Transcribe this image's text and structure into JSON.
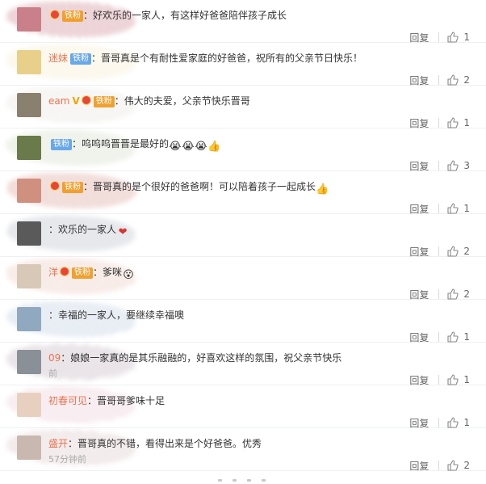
{
  "labels": {
    "reply": "回复"
  },
  "comments": [
    {
      "user": "",
      "fan": "铁粉",
      "fan_color": "orange",
      "medal": true,
      "vip": false,
      "text": "：好欢乐的一家人，有这样好爸爸陪伴孩子成长",
      "emojis": [],
      "time": "",
      "likes": "1",
      "avatar_color": "#c9808a",
      "scribble": "#b04050"
    },
    {
      "user": "迷妹",
      "fan": "铁粉",
      "fan_color": "blue",
      "medal": false,
      "vip": false,
      "text": "：晋哥真是个有耐性爱家庭的好爸爸，祝所有的父亲节日快乐！",
      "emojis": [],
      "time": "",
      "likes": "2",
      "avatar_color": "#e8d08a",
      "scribble": "#f0e0b0"
    },
    {
      "user": "eam",
      "fan": "铁粉",
      "fan_color": "orange",
      "medal": true,
      "vip": true,
      "text": "：伟大的夫爱，父亲节快乐晋哥",
      "emojis": [],
      "time": "",
      "likes": "1",
      "avatar_color": "#8a8070",
      "scribble": "#d8d4cc"
    },
    {
      "user": "",
      "fan": "铁粉",
      "fan_color": "blue",
      "medal": false,
      "vip": false,
      "text": "：呜呜呜晋晋是最好的",
      "emojis": [
        "😭",
        "😭",
        "😭",
        "👍"
      ],
      "time": "",
      "likes": "3",
      "avatar_color": "#6a7a4a",
      "scribble": "#b8c8a8"
    },
    {
      "user": "",
      "fan": "铁粉",
      "fan_color": "orange",
      "medal": true,
      "vip": false,
      "text": "：晋哥真的是个很好的爸爸啊！可以陪着孩子一起成长",
      "emojis": [
        "👍"
      ],
      "time": "",
      "likes": "1",
      "avatar_color": "#d09080",
      "scribble": "#c06a5a"
    },
    {
      "user": "",
      "fan": "",
      "fan_color": "",
      "medal": false,
      "vip": false,
      "text": "：欢乐的一家人",
      "emojis": [
        "❤"
      ],
      "time": "",
      "likes": "2",
      "avatar_color": "#5a5a5a",
      "scribble": "#9098a8"
    },
    {
      "user": "洋",
      "fan": "铁粉",
      "fan_color": "orange",
      "medal": true,
      "vip": false,
      "text": "：爹咪",
      "emojis": [
        "😮"
      ],
      "time": "",
      "likes": "2",
      "avatar_color": "#d8c8b8",
      "scribble": "#e0a898"
    },
    {
      "user": "",
      "fan": "",
      "fan_color": "",
      "medal": false,
      "vip": false,
      "text": "：幸福的一家人，要继续幸福噢",
      "emojis": [],
      "time": "",
      "likes": "1",
      "avatar_color": "#90a8c0",
      "scribble": "#98b0d0"
    },
    {
      "user": "09",
      "fan": "",
      "fan_color": "",
      "medal": false,
      "vip": false,
      "text": "：娘娘一家真的是其乐融融的，好喜欢这样的氛围，祝父亲节快乐",
      "emojis": [],
      "time": "前",
      "likes": "1",
      "avatar_color": "#8a9098",
      "scribble": "#a08898"
    },
    {
      "user": "初春可见",
      "fan": "",
      "fan_color": "",
      "medal": false,
      "vip": false,
      "text": "：晋哥哥爹味十足",
      "emojis": [],
      "time": "",
      "likes": "1",
      "avatar_color": "#e8d0c0",
      "scribble": "#e0b0c0"
    },
    {
      "user": "盛开",
      "fan": "",
      "fan_color": "",
      "medal": false,
      "vip": false,
      "text": "：晋哥真的不错，看得出来是个好爸爸。优秀",
      "emojis": [],
      "time": "57分钟前",
      "likes": "2",
      "avatar_color": "#c8b8b0",
      "scribble": "#c8a8a8"
    }
  ]
}
